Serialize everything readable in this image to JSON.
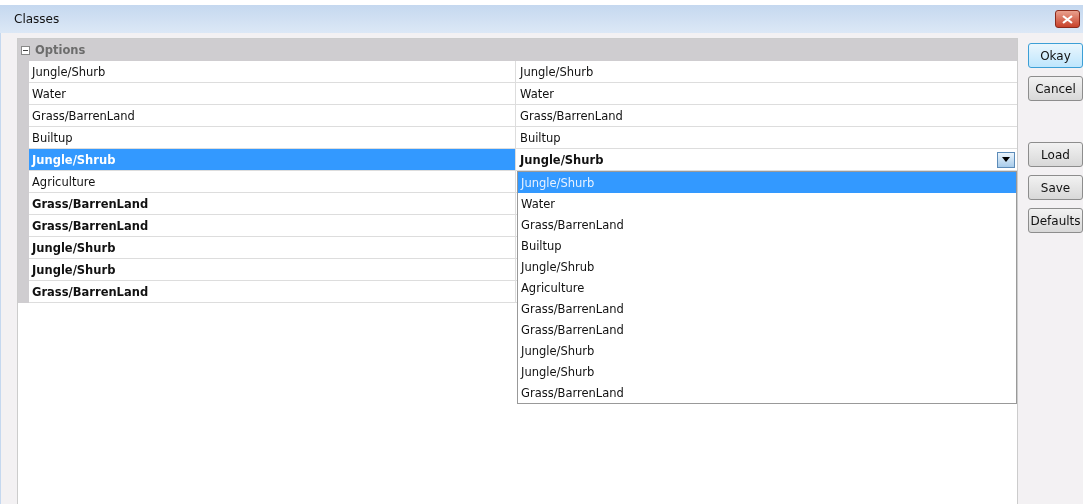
{
  "window": {
    "title": "Classes"
  },
  "category": {
    "label": "Options",
    "expanded": true
  },
  "rows": [
    {
      "name": "Jungle/Shurb",
      "modified": false,
      "selected": false,
      "value": "Jungle/Shurb"
    },
    {
      "name": "Water",
      "modified": false,
      "selected": false,
      "value": "Water"
    },
    {
      "name": "Grass/BarrenLand",
      "modified": false,
      "selected": false,
      "value": "Grass/BarrenLand"
    },
    {
      "name": "Builtup",
      "modified": false,
      "selected": false,
      "value": "Builtup"
    },
    {
      "name": "Jungle/Shrub",
      "modified": true,
      "selected": true,
      "value": "Jungle/Shurb",
      "editing": true
    },
    {
      "name": "Agriculture",
      "modified": false,
      "selected": false
    },
    {
      "name": "Grass/BarrenLand",
      "modified": true,
      "selected": false
    },
    {
      "name": "Grass/BarrenLand",
      "modified": true,
      "selected": false
    },
    {
      "name": "Jungle/Shurb",
      "modified": true,
      "selected": false
    },
    {
      "name": "Jungle/Shurb",
      "modified": true,
      "selected": false
    },
    {
      "name": "Grass/BarrenLand",
      "modified": true,
      "selected": false
    }
  ],
  "dropdown": {
    "options": [
      {
        "label": "Jungle/Shurb",
        "selected": true
      },
      {
        "label": "Water",
        "selected": false
      },
      {
        "label": "Grass/BarrenLand",
        "selected": false
      },
      {
        "label": "Builtup",
        "selected": false
      },
      {
        "label": "Jungle/Shrub",
        "selected": false
      },
      {
        "label": "Agriculture",
        "selected": false
      },
      {
        "label": "Grass/BarrenLand",
        "selected": false
      },
      {
        "label": "Grass/BarrenLand",
        "selected": false
      },
      {
        "label": "Jungle/Shurb",
        "selected": false
      },
      {
        "label": "Jungle/Shurb",
        "selected": false
      },
      {
        "label": "Grass/BarrenLand",
        "selected": false
      }
    ]
  },
  "button_groups": [
    [
      {
        "label": "Okay",
        "focused": true
      },
      {
        "label": "Cancel",
        "focused": false
      }
    ],
    [
      {
        "label": "Load",
        "focused": false
      },
      {
        "label": "Save",
        "focused": false
      },
      {
        "label": "Defaults",
        "focused": false
      }
    ]
  ]
}
